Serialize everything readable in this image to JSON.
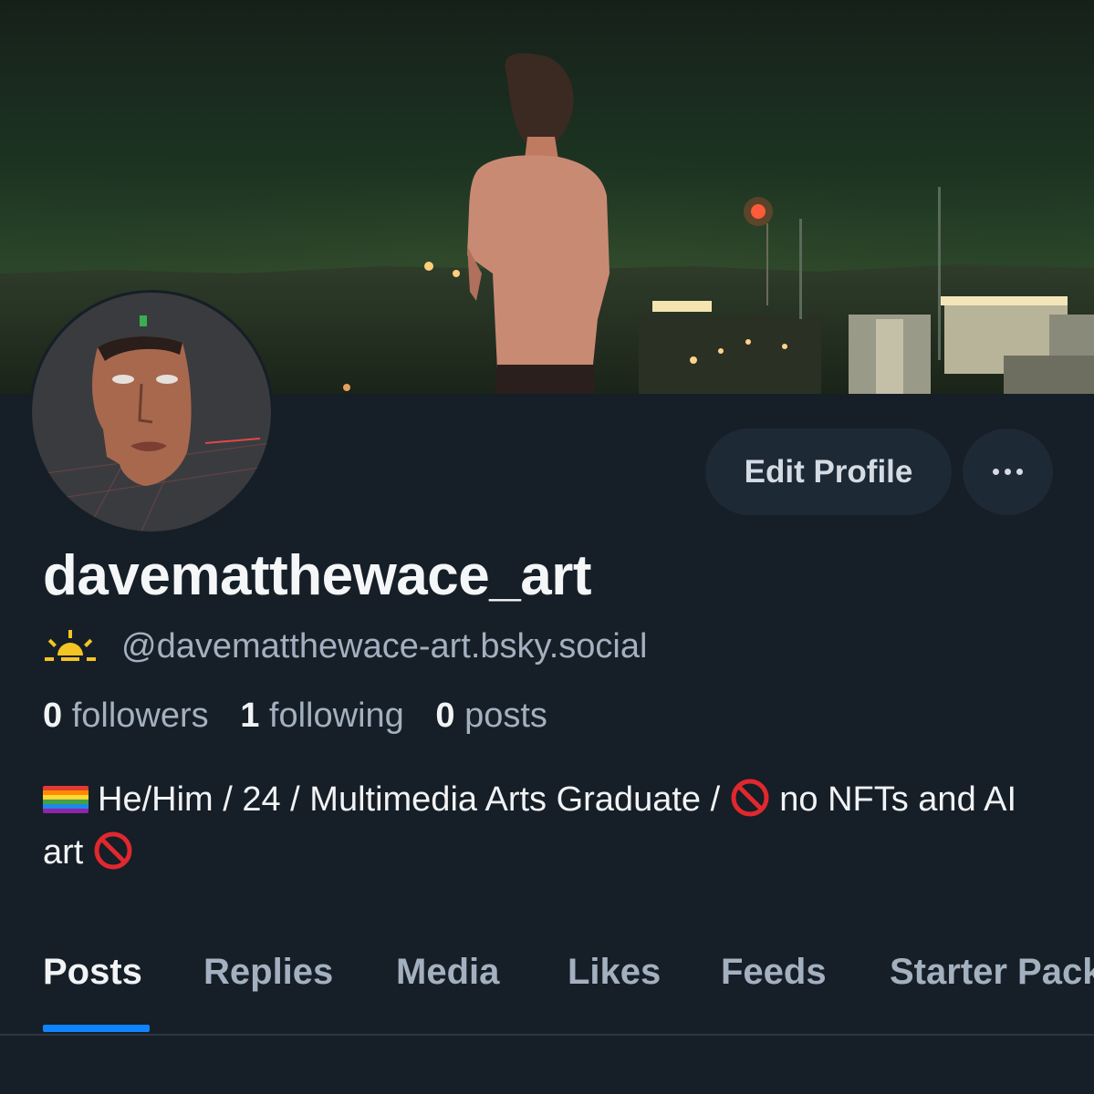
{
  "profile": {
    "display_name": "davematthewace_art",
    "handle": "@davematthewace-art.bsky.social",
    "handle_icon": "sunrise-icon",
    "stats": {
      "followers_count": "0",
      "followers_label": "followers",
      "following_count": "1",
      "following_label": "following",
      "posts_count": "0",
      "posts_label": "posts"
    },
    "bio": {
      "line_a": "He/Him / 24 / Multimedia Arts Graduate / ",
      "line_b": " no NFTs and AI art ",
      "icons": [
        "rainbow-flag-icon",
        "no-entry-icon"
      ]
    }
  },
  "actions": {
    "edit_profile_label": "Edit Profile",
    "more_icon": "ellipsis-icon"
  },
  "tabs": [
    {
      "label": "Posts",
      "active": true
    },
    {
      "label": "Replies",
      "active": false
    },
    {
      "label": "Media",
      "active": false
    },
    {
      "label": "Likes",
      "active": false
    },
    {
      "label": "Feeds",
      "active": false
    },
    {
      "label": "Starter Packs",
      "active": false
    }
  ],
  "colors": {
    "background": "#161e27",
    "button_bg": "#1e2936",
    "muted_text": "#a3b0bf",
    "accent": "#1083fe"
  }
}
